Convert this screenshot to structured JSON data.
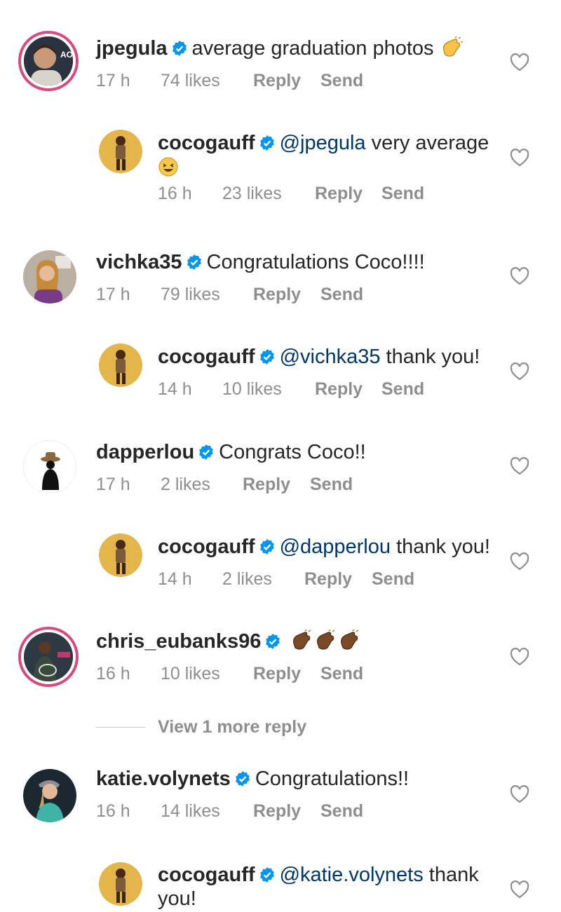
{
  "comments": [
    {
      "username": "jpegula",
      "text": "average graduation photos",
      "time": "17 h",
      "likes": "74 likes",
      "reply": "Reply",
      "send": "Send",
      "emoji": "clapping-hands"
    },
    {
      "username": "cocogauff",
      "mention": "@jpegula",
      "text": " very average",
      "time": "16 h",
      "likes": "23 likes",
      "reply": "Reply",
      "send": "Send",
      "emoji": "grinning-squinting-face"
    },
    {
      "username": "vichka35",
      "text": "Congratulations Coco!!!!",
      "time": "17 h",
      "likes": "79 likes",
      "reply": "Reply",
      "send": "Send"
    },
    {
      "username": "cocogauff",
      "mention": "@vichka35",
      "text": " thank you!",
      "time": "14 h",
      "likes": "10 likes",
      "reply": "Reply",
      "send": "Send"
    },
    {
      "username": "dapperlou",
      "text": "Congrats Coco!!",
      "time": "17 h",
      "likes": "2 likes",
      "reply": "Reply",
      "send": "Send"
    },
    {
      "username": "cocogauff",
      "mention": "@dapperlou",
      "text": " thank you!",
      "time": "14 h",
      "likes": "2 likes",
      "reply": "Reply",
      "send": "Send"
    },
    {
      "username": "chris_eubanks96",
      "text": "",
      "time": "16 h",
      "likes": "10 likes",
      "reply": "Reply",
      "send": "Send",
      "emoji": "clapping-hands-dark x3"
    },
    {
      "username": "katie.volynets",
      "text": "Congratulations!!",
      "time": "16 h",
      "likes": "14 likes",
      "reply": "Reply",
      "send": "Send"
    },
    {
      "username": "cocogauff",
      "mention": "@katie.volynets",
      "text": " thank",
      "text2": "you!"
    }
  ],
  "view_more": "View 1 more reply",
  "colors": {
    "verified": "#0095f6",
    "mention": "#00376b",
    "meta": "#8e8e8e",
    "story_ring": "#d64a7e"
  },
  "icons": {
    "like": "heart-outline-icon",
    "verified": "verified-badge-icon"
  }
}
